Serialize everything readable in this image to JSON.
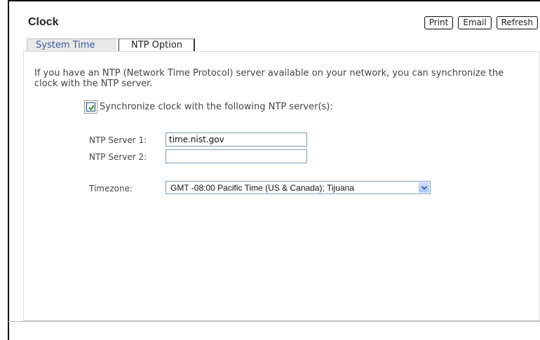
{
  "page": {
    "title": "Clock"
  },
  "toolbar": {
    "print": "Print",
    "email": "Email",
    "refresh": "Refresh"
  },
  "tabs": [
    {
      "label": "System Time",
      "active": false
    },
    {
      "label": "NTP Option",
      "active": true
    }
  ],
  "intro_text": "If you have an NTP (Network Time Protocol) server available on your network, you can synchronize the clock with the NTP server.",
  "sync": {
    "label": "Synchronize clock with the following NTP server(s):",
    "checked": true
  },
  "ntp": {
    "server1_label": "NTP Server 1:",
    "server1_value": "time.nist.gov",
    "server2_label": "NTP Server 2:",
    "server2_value": ""
  },
  "timezone": {
    "label": "Timezone:",
    "selected": "GMT -08:00 Pacific Time (US & Canada); Tijuana"
  },
  "colors": {
    "tab_text": "#3a5a9a",
    "check": "#2a9a2a",
    "input_border": "#7f9db9"
  }
}
